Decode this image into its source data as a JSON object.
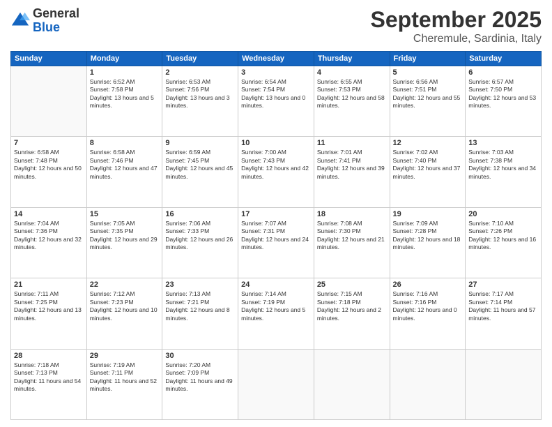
{
  "header": {
    "logo_general": "General",
    "logo_blue": "Blue",
    "month_title": "September 2025",
    "location": "Cheremule, Sardinia, Italy"
  },
  "weekdays": [
    "Sunday",
    "Monday",
    "Tuesday",
    "Wednesday",
    "Thursday",
    "Friday",
    "Saturday"
  ],
  "weeks": [
    [
      {
        "day": "",
        "sunrise": "",
        "sunset": "",
        "daylight": ""
      },
      {
        "day": "1",
        "sunrise": "Sunrise: 6:52 AM",
        "sunset": "Sunset: 7:58 PM",
        "daylight": "Daylight: 13 hours and 5 minutes."
      },
      {
        "day": "2",
        "sunrise": "Sunrise: 6:53 AM",
        "sunset": "Sunset: 7:56 PM",
        "daylight": "Daylight: 13 hours and 3 minutes."
      },
      {
        "day": "3",
        "sunrise": "Sunrise: 6:54 AM",
        "sunset": "Sunset: 7:54 PM",
        "daylight": "Daylight: 13 hours and 0 minutes."
      },
      {
        "day": "4",
        "sunrise": "Sunrise: 6:55 AM",
        "sunset": "Sunset: 7:53 PM",
        "daylight": "Daylight: 12 hours and 58 minutes."
      },
      {
        "day": "5",
        "sunrise": "Sunrise: 6:56 AM",
        "sunset": "Sunset: 7:51 PM",
        "daylight": "Daylight: 12 hours and 55 minutes."
      },
      {
        "day": "6",
        "sunrise": "Sunrise: 6:57 AM",
        "sunset": "Sunset: 7:50 PM",
        "daylight": "Daylight: 12 hours and 53 minutes."
      }
    ],
    [
      {
        "day": "7",
        "sunrise": "Sunrise: 6:58 AM",
        "sunset": "Sunset: 7:48 PM",
        "daylight": "Daylight: 12 hours and 50 minutes."
      },
      {
        "day": "8",
        "sunrise": "Sunrise: 6:58 AM",
        "sunset": "Sunset: 7:46 PM",
        "daylight": "Daylight: 12 hours and 47 minutes."
      },
      {
        "day": "9",
        "sunrise": "Sunrise: 6:59 AM",
        "sunset": "Sunset: 7:45 PM",
        "daylight": "Daylight: 12 hours and 45 minutes."
      },
      {
        "day": "10",
        "sunrise": "Sunrise: 7:00 AM",
        "sunset": "Sunset: 7:43 PM",
        "daylight": "Daylight: 12 hours and 42 minutes."
      },
      {
        "day": "11",
        "sunrise": "Sunrise: 7:01 AM",
        "sunset": "Sunset: 7:41 PM",
        "daylight": "Daylight: 12 hours and 39 minutes."
      },
      {
        "day": "12",
        "sunrise": "Sunrise: 7:02 AM",
        "sunset": "Sunset: 7:40 PM",
        "daylight": "Daylight: 12 hours and 37 minutes."
      },
      {
        "day": "13",
        "sunrise": "Sunrise: 7:03 AM",
        "sunset": "Sunset: 7:38 PM",
        "daylight": "Daylight: 12 hours and 34 minutes."
      }
    ],
    [
      {
        "day": "14",
        "sunrise": "Sunrise: 7:04 AM",
        "sunset": "Sunset: 7:36 PM",
        "daylight": "Daylight: 12 hours and 32 minutes."
      },
      {
        "day": "15",
        "sunrise": "Sunrise: 7:05 AM",
        "sunset": "Sunset: 7:35 PM",
        "daylight": "Daylight: 12 hours and 29 minutes."
      },
      {
        "day": "16",
        "sunrise": "Sunrise: 7:06 AM",
        "sunset": "Sunset: 7:33 PM",
        "daylight": "Daylight: 12 hours and 26 minutes."
      },
      {
        "day": "17",
        "sunrise": "Sunrise: 7:07 AM",
        "sunset": "Sunset: 7:31 PM",
        "daylight": "Daylight: 12 hours and 24 minutes."
      },
      {
        "day": "18",
        "sunrise": "Sunrise: 7:08 AM",
        "sunset": "Sunset: 7:30 PM",
        "daylight": "Daylight: 12 hours and 21 minutes."
      },
      {
        "day": "19",
        "sunrise": "Sunrise: 7:09 AM",
        "sunset": "Sunset: 7:28 PM",
        "daylight": "Daylight: 12 hours and 18 minutes."
      },
      {
        "day": "20",
        "sunrise": "Sunrise: 7:10 AM",
        "sunset": "Sunset: 7:26 PM",
        "daylight": "Daylight: 12 hours and 16 minutes."
      }
    ],
    [
      {
        "day": "21",
        "sunrise": "Sunrise: 7:11 AM",
        "sunset": "Sunset: 7:25 PM",
        "daylight": "Daylight: 12 hours and 13 minutes."
      },
      {
        "day": "22",
        "sunrise": "Sunrise: 7:12 AM",
        "sunset": "Sunset: 7:23 PM",
        "daylight": "Daylight: 12 hours and 10 minutes."
      },
      {
        "day": "23",
        "sunrise": "Sunrise: 7:13 AM",
        "sunset": "Sunset: 7:21 PM",
        "daylight": "Daylight: 12 hours and 8 minutes."
      },
      {
        "day": "24",
        "sunrise": "Sunrise: 7:14 AM",
        "sunset": "Sunset: 7:19 PM",
        "daylight": "Daylight: 12 hours and 5 minutes."
      },
      {
        "day": "25",
        "sunrise": "Sunrise: 7:15 AM",
        "sunset": "Sunset: 7:18 PM",
        "daylight": "Daylight: 12 hours and 2 minutes."
      },
      {
        "day": "26",
        "sunrise": "Sunrise: 7:16 AM",
        "sunset": "Sunset: 7:16 PM",
        "daylight": "Daylight: 12 hours and 0 minutes."
      },
      {
        "day": "27",
        "sunrise": "Sunrise: 7:17 AM",
        "sunset": "Sunset: 7:14 PM",
        "daylight": "Daylight: 11 hours and 57 minutes."
      }
    ],
    [
      {
        "day": "28",
        "sunrise": "Sunrise: 7:18 AM",
        "sunset": "Sunset: 7:13 PM",
        "daylight": "Daylight: 11 hours and 54 minutes."
      },
      {
        "day": "29",
        "sunrise": "Sunrise: 7:19 AM",
        "sunset": "Sunset: 7:11 PM",
        "daylight": "Daylight: 11 hours and 52 minutes."
      },
      {
        "day": "30",
        "sunrise": "Sunrise: 7:20 AM",
        "sunset": "Sunset: 7:09 PM",
        "daylight": "Daylight: 11 hours and 49 minutes."
      },
      {
        "day": "",
        "sunrise": "",
        "sunset": "",
        "daylight": ""
      },
      {
        "day": "",
        "sunrise": "",
        "sunset": "",
        "daylight": ""
      },
      {
        "day": "",
        "sunrise": "",
        "sunset": "",
        "daylight": ""
      },
      {
        "day": "",
        "sunrise": "",
        "sunset": "",
        "daylight": ""
      }
    ]
  ]
}
